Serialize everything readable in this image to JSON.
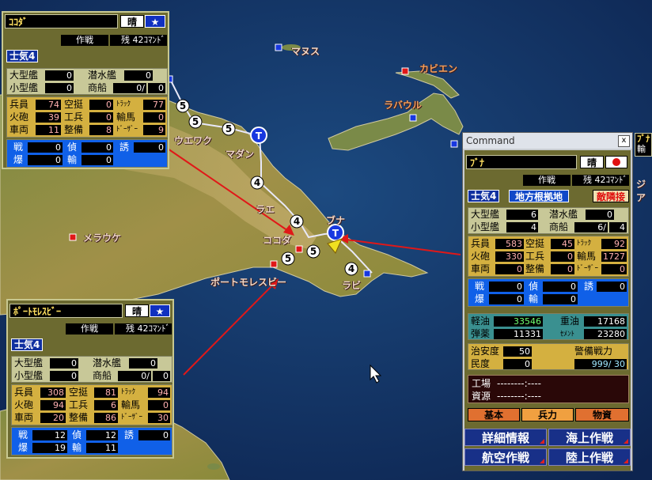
{
  "map": {
    "places": [
      {
        "id": "maasu",
        "name": "マヌス"
      },
      {
        "id": "kavieng",
        "name": "カビエン"
      },
      {
        "id": "rabaul",
        "name": "ラバウル"
      },
      {
        "id": "wewak",
        "name": "ウエワク"
      },
      {
        "id": "madang",
        "name": "マダン"
      },
      {
        "id": "lae",
        "name": "ラエ"
      },
      {
        "id": "buna",
        "name": "ブナ"
      },
      {
        "id": "kokoda",
        "name": "ココダ"
      },
      {
        "id": "rabi",
        "name": "ラビ"
      },
      {
        "id": "merauke",
        "name": "メラウケ"
      },
      {
        "id": "port_moresby",
        "name": "ポートモレスビー"
      }
    ],
    "route_numbers": [
      "5",
      "5",
      "5",
      "4",
      "4",
      "5",
      "5",
      "4"
    ],
    "markers": [
      "T",
      "T"
    ]
  },
  "kokoda_panel": {
    "name": "ｺｺﾀﾞ",
    "weather": "晴",
    "operation": "作戦",
    "remaining": "残 42ｺﾏﾝﾄﾞ",
    "morale": "士気4",
    "ships": [
      {
        "label": "大型艦",
        "value": "0"
      },
      {
        "label": "潜水艦",
        "value": "0"
      },
      {
        "label": "小型艦",
        "value": "0"
      },
      {
        "label": "商船",
        "value": "0/",
        "value2": "0"
      }
    ],
    "forces": [
      {
        "label": "兵員",
        "value": "74"
      },
      {
        "label": "空挺",
        "value": "0"
      },
      {
        "label": "ﾄﾗｯｸ",
        "value": "77"
      },
      {
        "label": "火砲",
        "value": "39"
      },
      {
        "label": "工兵",
        "value": "0"
      },
      {
        "label": "輸馬",
        "value": "0"
      },
      {
        "label": "車両",
        "value": "11"
      },
      {
        "label": "整備",
        "value": "8"
      },
      {
        "label": "ﾄﾞｰｻﾞｰ",
        "value": "9"
      }
    ],
    "air": [
      {
        "label": "戦",
        "value": "0"
      },
      {
        "label": "偵",
        "value": "0"
      },
      {
        "label": "誘",
        "value": "0"
      },
      {
        "label": "爆",
        "value": "0"
      },
      {
        "label": "輸",
        "value": "0"
      }
    ]
  },
  "moresby_panel": {
    "name": "ﾎﾟｰﾄﾓﾚｽﾋﾞｰ",
    "weather": "晴",
    "operation": "作戦",
    "remaining": "残 42ｺﾏﾝﾄﾞ",
    "morale": "士気4",
    "ships": [
      {
        "label": "大型艦",
        "value": "0"
      },
      {
        "label": "潜水艦",
        "value": "0"
      },
      {
        "label": "小型艦",
        "value": "0"
      },
      {
        "label": "商船",
        "value": "0/",
        "value2": "0"
      }
    ],
    "forces": [
      {
        "label": "兵員",
        "value": "308"
      },
      {
        "label": "空挺",
        "value": "81"
      },
      {
        "label": "ﾄﾗｯｸ",
        "value": "94"
      },
      {
        "label": "火砲",
        "value": "94"
      },
      {
        "label": "工兵",
        "value": "6"
      },
      {
        "label": "輸馬",
        "value": "0"
      },
      {
        "label": "車両",
        "value": "20"
      },
      {
        "label": "整備",
        "value": "86"
      },
      {
        "label": "ﾄﾞｰｻﾞｰ",
        "value": "30"
      }
    ],
    "air": [
      {
        "label": "戦",
        "value": "12"
      },
      {
        "label": "偵",
        "value": "12"
      },
      {
        "label": "誘",
        "value": "0"
      },
      {
        "label": "爆",
        "value": "19"
      },
      {
        "label": "輸",
        "value": "11"
      }
    ]
  },
  "command": {
    "window_title": "Command",
    "close": "x",
    "base_name": "ﾌﾞﾅ",
    "weather": "晴",
    "operation": "作戦",
    "remaining": "残 42ｺﾏﾝﾄﾞ",
    "morale": "士気4",
    "base_type": "地方根拠地",
    "enemy_adjacent": "敵隣接",
    "ships": [
      {
        "label": "大型艦",
        "value": "6"
      },
      {
        "label": "潜水艦",
        "value": "0"
      },
      {
        "label": "小型艦",
        "value": "4"
      },
      {
        "label": "商船",
        "value": "6/",
        "value2": "4"
      }
    ],
    "forces": [
      {
        "label": "兵員",
        "value": "583"
      },
      {
        "label": "空挺",
        "value": "45"
      },
      {
        "label": "ﾄﾗｯｸ",
        "value": "92"
      },
      {
        "label": "火砲",
        "value": "330"
      },
      {
        "label": "工兵",
        "value": "0"
      },
      {
        "label": "輸馬",
        "value": "1727"
      },
      {
        "label": "車両",
        "value": "0"
      },
      {
        "label": "整備",
        "value": "0"
      },
      {
        "label": "ﾄﾞｰｻﾞｰ",
        "value": "0"
      }
    ],
    "air": [
      {
        "label": "戦",
        "value": "0"
      },
      {
        "label": "偵",
        "value": "0"
      },
      {
        "label": "誘",
        "value": "0"
      },
      {
        "label": "爆",
        "value": "0"
      },
      {
        "label": "輸",
        "value": "0"
      }
    ],
    "supplies": [
      {
        "label": "軽油",
        "value": "33546"
      },
      {
        "label": "重油",
        "value": "17168"
      },
      {
        "label": "弾薬",
        "value": "11331"
      },
      {
        "label": "ｾﾒﾝﾄ",
        "value": "23280"
      }
    ],
    "security_label": "治安度",
    "security_value": "50",
    "garrison_label": "警備戦力",
    "garrison_value": "999/ 30",
    "morale_label": "民度",
    "morale_value": "0",
    "factory_label": "工場",
    "factory_value": "--------:----",
    "resource_label": "資源",
    "resource_value": "--------:----",
    "tabs": [
      "基本",
      "兵力",
      "物資"
    ],
    "buttons": [
      "詳細情報",
      "海上作戦",
      "航空作戦",
      "陸上作戦"
    ]
  },
  "edge_panel": {
    "line1": "ﾌﾞﾅ",
    "line2": "輸",
    "line3": "ジア"
  }
}
